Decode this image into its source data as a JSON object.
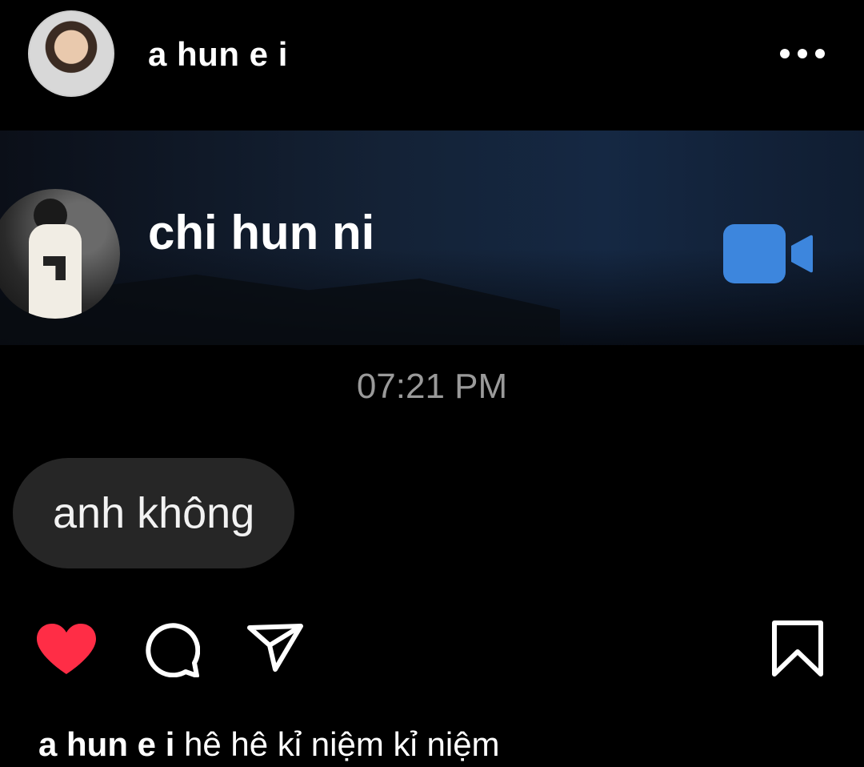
{
  "post": {
    "author": "a hun e i",
    "more_icon": "more-horizontal-icon"
  },
  "call_banner": {
    "caller_name": "chi hun ni",
    "call_icon": "video-camera-icon",
    "icon_color": "#3d86dd"
  },
  "chat": {
    "timestamp": "07:21 PM",
    "message": "anh không"
  },
  "actions": {
    "like_icon": "heart-filled-icon",
    "like_color": "#ff2d46",
    "comment_icon": "comment-icon",
    "share_icon": "send-icon",
    "save_icon": "bookmark-icon"
  },
  "caption": {
    "username": "a hun e i",
    "text": "hê hê kỉ niệm kỉ niệm"
  }
}
